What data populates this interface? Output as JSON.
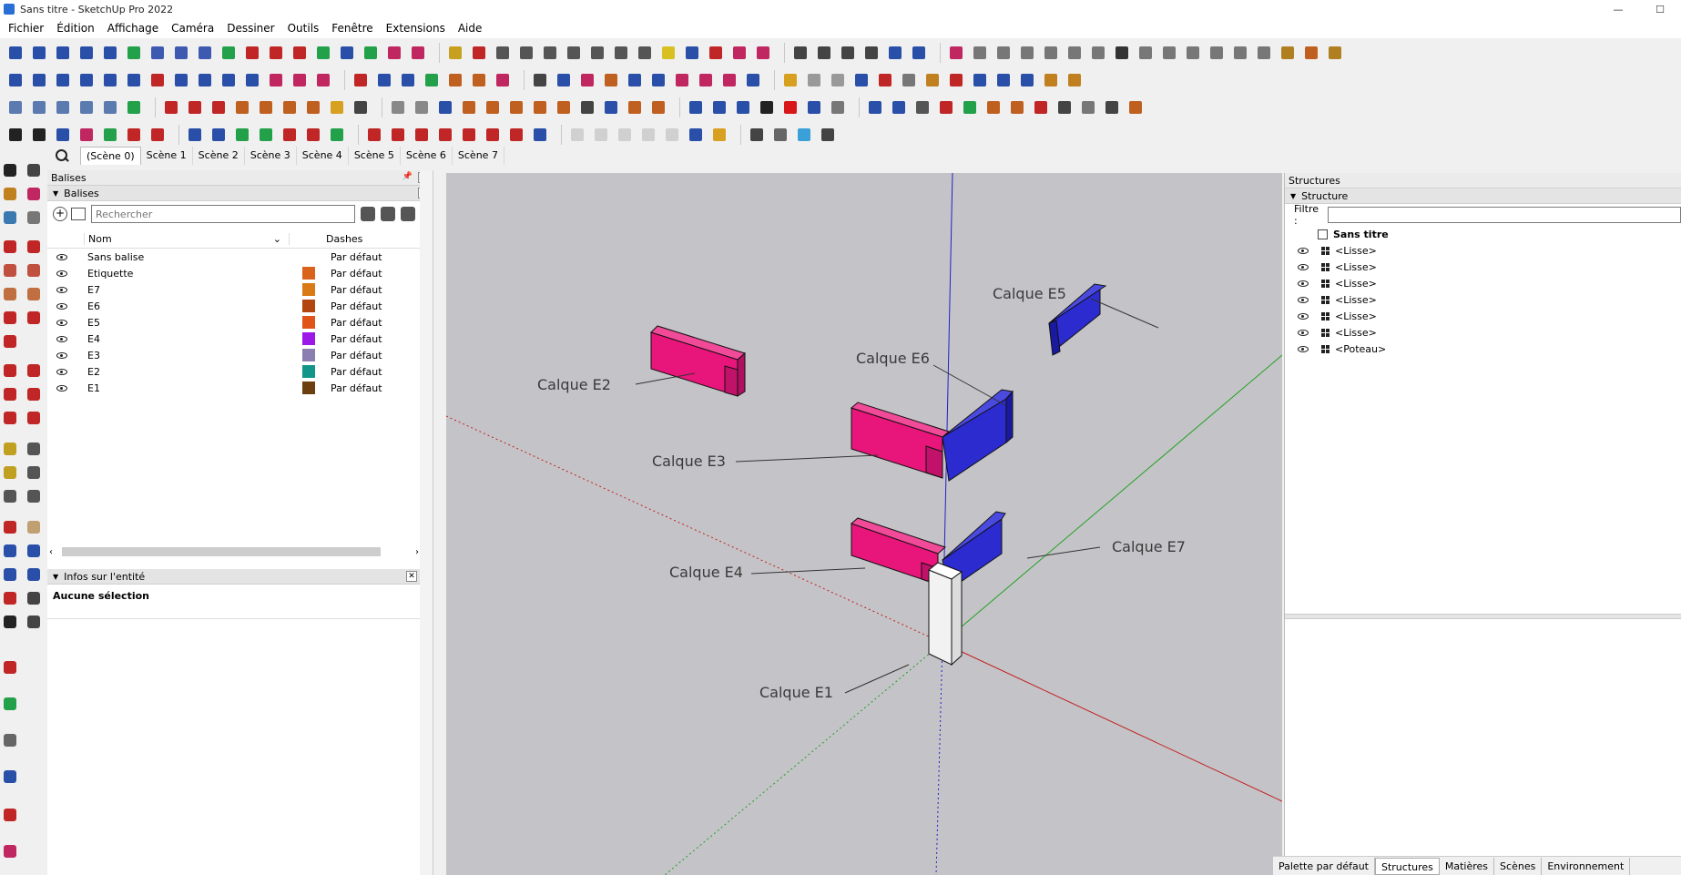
{
  "window": {
    "title": "Sans titre - SketchUp Pro 2022",
    "minimize": "—",
    "maximize": "☐",
    "close": "✕"
  },
  "menu": [
    "Fichier",
    "Édition",
    "Affichage",
    "Caméra",
    "Dessiner",
    "Outils",
    "Fenêtre",
    "Extensions",
    "Aide"
  ],
  "scenes": {
    "tabs": [
      "(Scène 0)",
      "Scène 1",
      "Scène 2",
      "Scène 3",
      "Scène 4",
      "Scène 5",
      "Scène 6",
      "Scène 7"
    ],
    "active": 0
  },
  "left_panel": {
    "title": "Balises",
    "tags_section": "Balises",
    "search_placeholder": "Rechercher",
    "columns": {
      "name": "Nom",
      "dashes": "Dashes"
    },
    "tags": [
      {
        "name": "Sans balise",
        "color": "",
        "dash": "Par défaut"
      },
      {
        "name": "Etiquette",
        "color": "#d9631a",
        "dash": "Par défaut"
      },
      {
        "name": "E7",
        "color": "#d97a14",
        "dash": "Par défaut"
      },
      {
        "name": "E6",
        "color": "#b3460e",
        "dash": "Par défaut"
      },
      {
        "name": "E5",
        "color": "#e0541a",
        "dash": "Par défaut"
      },
      {
        "name": "E4",
        "color": "#9b18e6",
        "dash": "Par défaut"
      },
      {
        "name": "E3",
        "color": "#8a7fb0",
        "dash": "Par défaut"
      },
      {
        "name": "E2",
        "color": "#13968a",
        "dash": "Par défaut"
      },
      {
        "name": "E1",
        "color": "#6b3f0f",
        "dash": "Par défaut"
      }
    ],
    "entity_section": "Infos sur l'entité",
    "entity_text": "Aucune sélection"
  },
  "viewport": {
    "labels": [
      "Calque E2",
      "Calque E3",
      "Calque E4",
      "Calque E1",
      "Calque E5",
      "Calque E6",
      "Calque E7"
    ],
    "pink": "#e8157a",
    "blue": "#2b2bd0",
    "bg": "#c4c4c8"
  },
  "right_panel": {
    "title": "Structures",
    "section": "Structure",
    "filter_label": "Filtre :",
    "root": "Sans titre",
    "items": [
      "<Lisse>",
      "<Lisse>",
      "<Lisse>",
      "<Lisse>",
      "<Lisse>",
      "<Lisse>",
      "<Poteau>"
    ]
  },
  "bottom_tabs": {
    "tabs": [
      "Palette par défaut",
      "Structures",
      "Matières",
      "Scènes",
      "Environnement"
    ],
    "active": 1
  }
}
